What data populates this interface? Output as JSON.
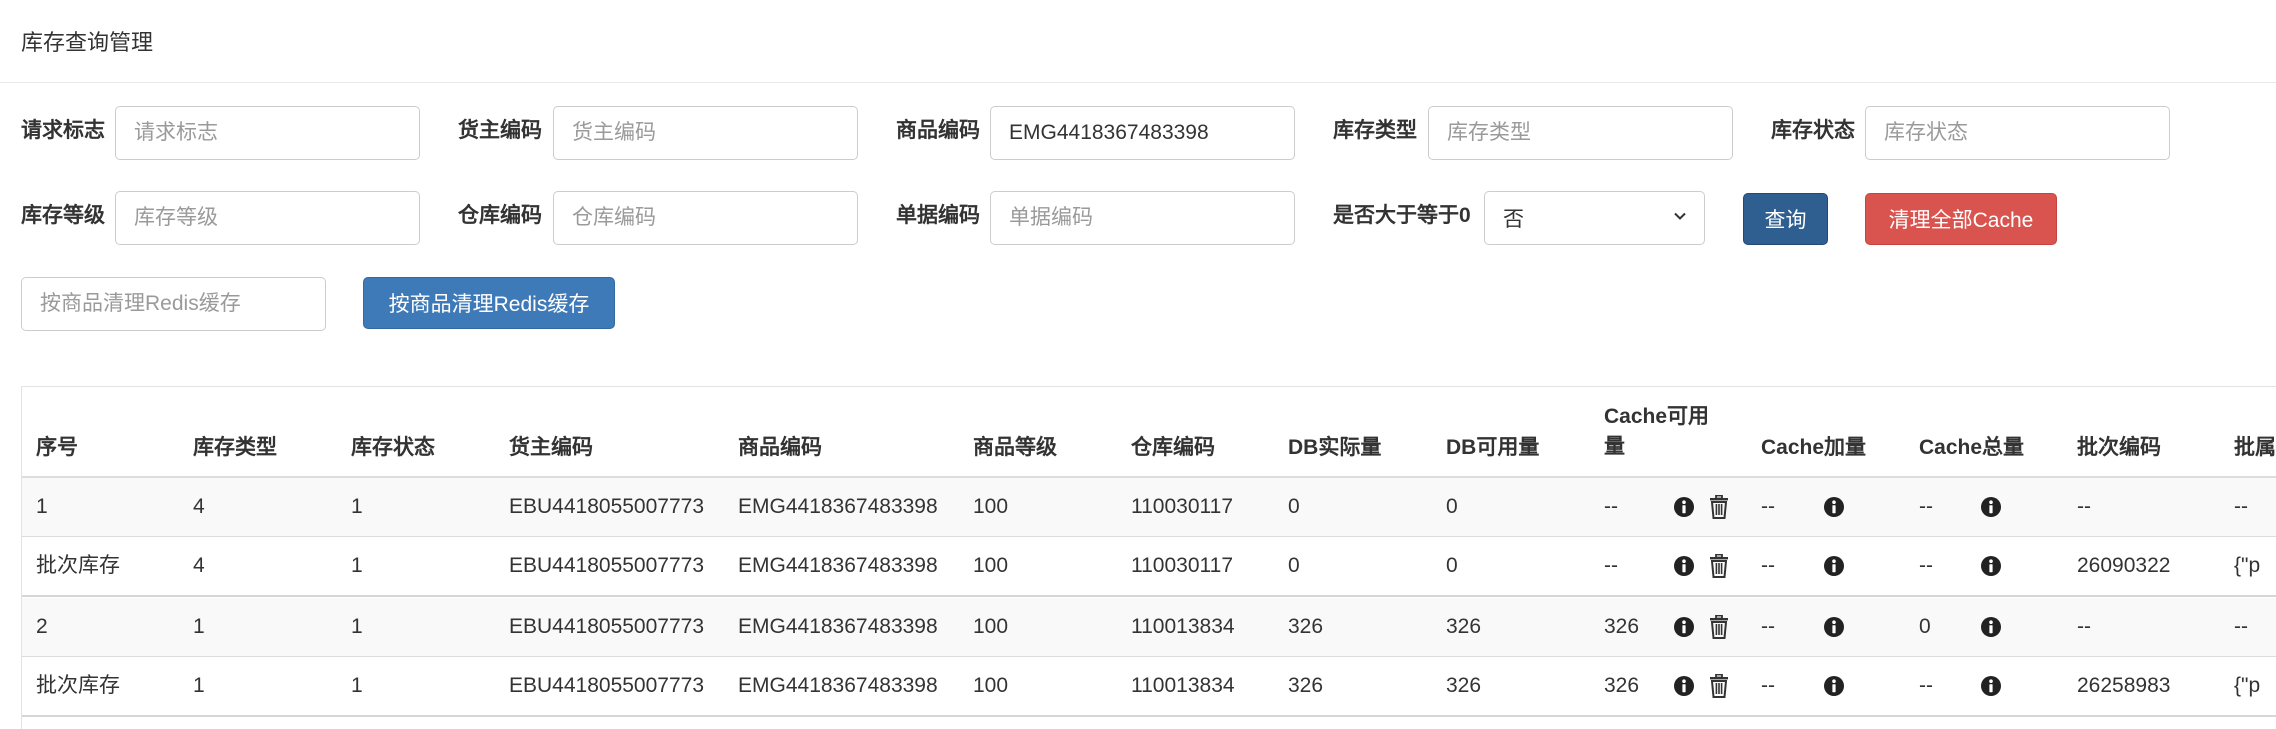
{
  "header": {
    "title": "库存查询管理"
  },
  "filters": {
    "request_flag": {
      "label": "请求标志",
      "placeholder": "请求标志",
      "value": ""
    },
    "owner_code": {
      "label": "货主编码",
      "placeholder": "货主编码",
      "value": ""
    },
    "product_code": {
      "label": "商品编码",
      "placeholder": "商品编码",
      "value": "EMG4418367483398"
    },
    "stock_type": {
      "label": "库存类型",
      "placeholder": "库存类型",
      "value": ""
    },
    "stock_status": {
      "label": "库存状态",
      "placeholder": "库存状态",
      "value": ""
    },
    "stock_grade": {
      "label": "库存等级",
      "placeholder": "库存等级",
      "value": ""
    },
    "warehouse_code": {
      "label": "仓库编码",
      "placeholder": "仓库编码",
      "value": ""
    },
    "doc_code": {
      "label": "单据编码",
      "placeholder": "单据编码",
      "value": ""
    },
    "gte_zero": {
      "label": "是否大于等于0",
      "selected": "否"
    },
    "query_button": "查询",
    "clear_all_cache_button": "清理全部Cache",
    "redis_clear_input": {
      "placeholder": "按商品清理Redis缓存",
      "value": ""
    },
    "redis_clear_button": "按商品清理Redis缓存"
  },
  "table": {
    "columns": [
      "序号",
      "库存类型",
      "库存状态",
      "货主编码",
      "商品编码",
      "商品等级",
      "仓库编码",
      "DB实际量",
      "DB可用量",
      "Cache可用量",
      "Cache加量",
      "Cache总量",
      "批次编码",
      "批属"
    ],
    "rows": [
      [
        "1",
        "4",
        "1",
        "EBU4418055007773",
        "EMG4418367483398",
        "100",
        "110030117",
        "0",
        "0",
        "--",
        "--",
        "--",
        "--",
        "--"
      ],
      [
        "批次库存",
        "4",
        "1",
        "EBU4418055007773",
        "EMG4418367483398",
        "100",
        "110030117",
        "0",
        "0",
        "--",
        "--",
        "--",
        "26090322",
        "{\"p"
      ],
      [
        "2",
        "1",
        "1",
        "EBU4418055007773",
        "EMG4418367483398",
        "100",
        "110013834",
        "326",
        "326",
        "326",
        "--",
        "0",
        "--",
        "--"
      ],
      [
        "批次库存",
        "1",
        "1",
        "EBU4418055007773",
        "EMG4418367483398",
        "100",
        "110013834",
        "326",
        "326",
        "326",
        "--",
        "--",
        "26258983",
        "{\"p"
      ]
    ]
  },
  "colors": {
    "primary_dark": "#2f5e91",
    "danger": "#d9534f",
    "primary": "#3e7ab8"
  },
  "icons": [
    "info-icon",
    "trash-icon",
    "chevron-down-icon"
  ]
}
